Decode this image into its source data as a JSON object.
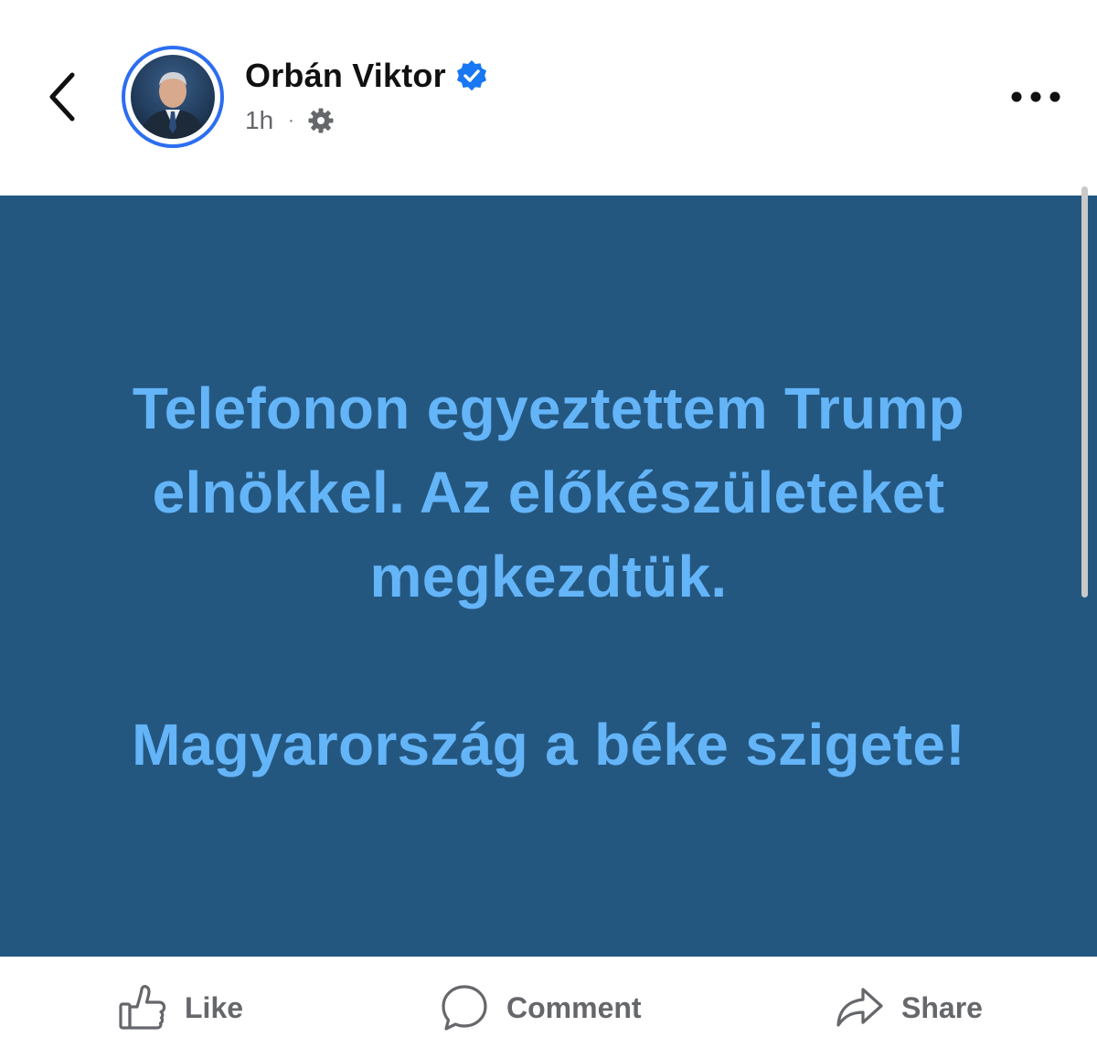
{
  "header": {
    "author_name": "Orbán Viktor",
    "timestamp": "1h",
    "meta_separator": "·",
    "audience_icon": "gear-icon",
    "verified_icon": "verified-badge-icon",
    "back_icon": "chevron-left-icon",
    "more_icon": "more-dots-icon"
  },
  "post": {
    "paragraphs": [
      "Telefonon egyeztettem Trump elnökkel. Az előkészületeket megkezdtük.",
      "Magyarország a béke szigete!"
    ],
    "background_color": "#245780",
    "text_color": "#64b4f8"
  },
  "actions": {
    "like_label": "Like",
    "comment_label": "Comment",
    "share_label": "Share"
  },
  "colors": {
    "accent": "#2d6ef0",
    "secondary_text": "#65676b"
  }
}
